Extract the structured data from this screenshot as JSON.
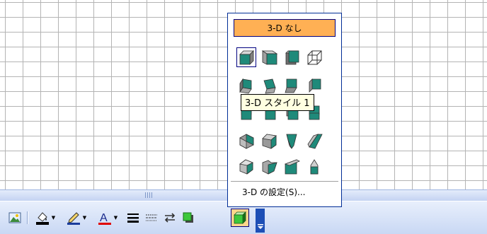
{
  "menu": {
    "no_3d_label": "3-D なし",
    "settings_label": "3-D の設定(S)..."
  },
  "tooltip": {
    "text": "3-D スタイル 1"
  },
  "styles": [
    "3d-style-1-icon",
    "3d-style-2-icon",
    "3d-style-3-icon",
    "3d-style-4-icon",
    "3d-style-5-icon",
    "3d-style-6-icon",
    "3d-style-7-icon",
    "3d-style-8-icon",
    "3d-style-9-icon",
    "3d-style-10-icon",
    "3d-style-11-icon",
    "3d-style-12-icon",
    "3d-style-13-icon",
    "3d-style-14-icon",
    "3d-style-15-icon",
    "3d-style-16-icon",
    "3d-style-17-icon",
    "3d-style-18-icon",
    "3d-style-19-icon",
    "3d-style-20-icon"
  ],
  "toolbar": {
    "icons": [
      "insert-picture-icon",
      "fill-color-icon",
      "line-color-icon",
      "font-color-icon",
      "line-style-icon",
      "dash-style-icon",
      "arrow-style-icon",
      "shadow-style-icon",
      "3d-style-icon"
    ]
  },
  "colors": {
    "accent": "#ffb054",
    "frame": "#002d96",
    "face": "#1f8a7a"
  }
}
